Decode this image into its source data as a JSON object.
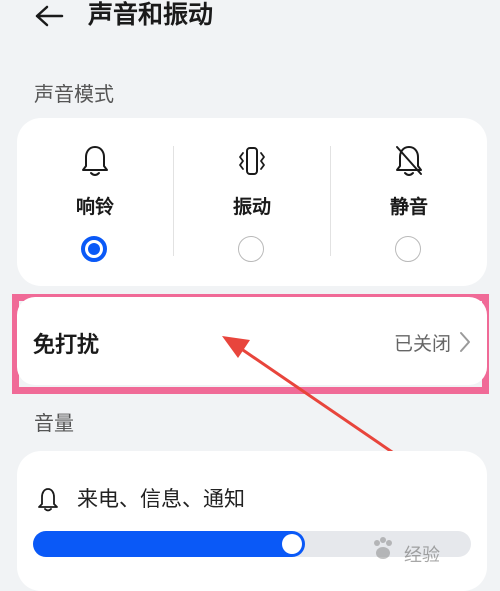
{
  "header": {
    "title": "声音和振动"
  },
  "sound_mode": {
    "title": "声音模式",
    "options": [
      {
        "label": "响铃",
        "icon": "bell-icon",
        "selected": true
      },
      {
        "label": "振动",
        "icon": "vibrate-icon",
        "selected": false
      },
      {
        "label": "静音",
        "icon": "bell-off-icon",
        "selected": false
      }
    ]
  },
  "dnd": {
    "label": "免打扰",
    "value": "已关闭"
  },
  "volume": {
    "title": "音量",
    "items": [
      {
        "label": "来电、信息、通知",
        "icon": "bell-icon",
        "level": 0.62
      }
    ]
  },
  "colors": {
    "accent": "#0a59f7",
    "highlight": "#f06a97",
    "arrow": "#e8453c"
  },
  "watermark": {
    "text": "经验"
  }
}
